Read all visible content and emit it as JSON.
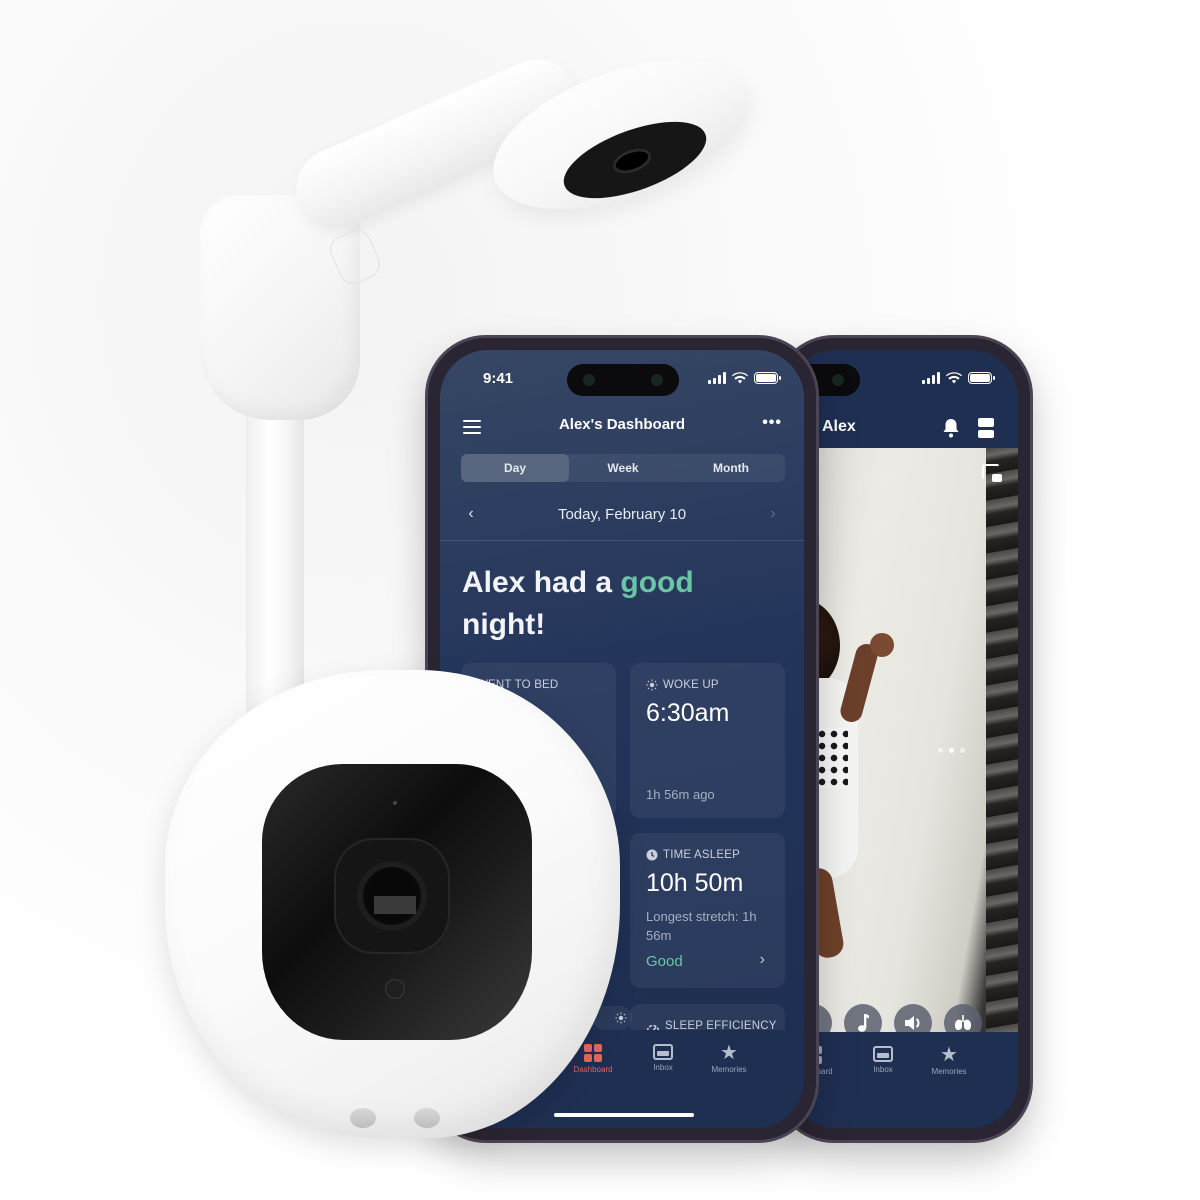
{
  "scene": {
    "description": "Product marketing composite: wall-mounted baby monitor camera, tabletop camera, and two smartphones running the monitor app"
  },
  "colors": {
    "app_background": "#22345a",
    "accent_good": "#6cc4a6",
    "tab_active": "#e0645f",
    "text_primary": "#ffffff"
  },
  "phone_front": {
    "status_bar": {
      "time": "9:41"
    },
    "header": {
      "title": "Alex's Dashboard",
      "menu_icon": "hamburger-icon",
      "more_icon": "more-horizontal-icon",
      "more_glyph": "•••"
    },
    "segmented": [
      {
        "label": "Day",
        "active": true
      },
      {
        "label": "Week",
        "active": false
      },
      {
        "label": "Month",
        "active": false
      }
    ],
    "date_nav": {
      "prev": "‹",
      "label": "Today, February 10",
      "next": "›"
    },
    "headline": {
      "prefix": "Alex had a ",
      "highlight": "good",
      "suffix": " night!"
    },
    "cards": {
      "went_to_bed": {
        "label": "WENT TO BED"
      },
      "woke_up": {
        "label": "WOKE UP",
        "icon": "sun-icon",
        "value": "6:30am",
        "sub": "1h 56m ago"
      },
      "time_asleep": {
        "label": "TIME ASLEEP",
        "icon": "clock-icon",
        "value": "10h 50m",
        "sub": "Longest stretch: 1h 56m",
        "status": "Good",
        "chevron": "›"
      },
      "sleep_efficiency": {
        "label": "SLEEP EFFICIENCY",
        "icon": "gauge-icon"
      }
    },
    "tabbar": [
      {
        "label": "Dashboard",
        "icon": "grid-icon",
        "active": true
      },
      {
        "label": "Inbox",
        "icon": "inbox-icon",
        "active": false
      },
      {
        "label": "Memories",
        "icon": "star-icon",
        "active": false
      }
    ]
  },
  "phone_back": {
    "header": {
      "title": "Alex",
      "bell_icon": "bell-icon",
      "layout_icon": "layout-icon"
    },
    "video": {
      "overlay_text": "%",
      "pip_icon": "picture-in-picture-icon",
      "page_count": 3,
      "active_page": 2
    },
    "controls": [
      {
        "name": "night-light",
        "icon": "lightbulb-icon",
        "glyph": "💡"
      },
      {
        "name": "sounds",
        "icon": "music-note-icon",
        "glyph": "♪"
      },
      {
        "name": "volume",
        "icon": "speaker-icon",
        "glyph": "🔈"
      },
      {
        "name": "breathing",
        "icon": "lungs-icon",
        "glyph": "❦"
      }
    ],
    "tabbar": [
      {
        "label": "Dashboard",
        "icon": "grid-icon"
      },
      {
        "label": "Inbox",
        "icon": "inbox-icon"
      },
      {
        "label": "Memories",
        "icon": "star-icon"
      }
    ]
  }
}
